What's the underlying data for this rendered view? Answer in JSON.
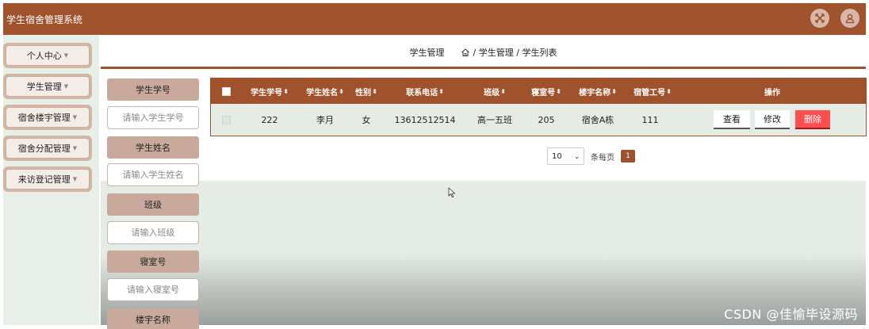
{
  "app": {
    "title": "学生宿舍管理系统"
  },
  "header_icons": [
    {
      "icon": "fullscreen-icon"
    },
    {
      "icon": "user-icon"
    }
  ],
  "sidebar": {
    "items": [
      {
        "label": "个人中心"
      },
      {
        "label": "学生管理"
      },
      {
        "label": "宿舍楼宇管理"
      },
      {
        "label": "宿舍分配管理"
      },
      {
        "label": "来访登记管理"
      }
    ]
  },
  "breadcrumb": {
    "section": "学生管理",
    "path": "/ 学生管理 / 学生列表",
    "home_icon": "home-icon"
  },
  "filters": [
    {
      "label": "学生学号",
      "placeholder": "请输入学生学号"
    },
    {
      "label": "学生姓名",
      "placeholder": "请输入学生姓名"
    },
    {
      "label": "班级",
      "placeholder": "请输入班级"
    },
    {
      "label": "寝室号",
      "placeholder": "请输入寝室号"
    },
    {
      "label": "楼宇名称",
      "placeholder": ""
    }
  ],
  "table": {
    "headers": {
      "student_id": "学生学号",
      "student_name": "学生姓名",
      "gender": "性别",
      "phone": "联系电话",
      "class": "班级",
      "room": "寝室号",
      "building": "楼宇名称",
      "manager_id": "宿管工号",
      "actions": "操作"
    },
    "rows": [
      {
        "student_id": "222",
        "student_name": "李月",
        "gender": "女",
        "phone": "13612512514",
        "class": "高一五班",
        "room": "205",
        "building": "宿舍A栋",
        "manager_id": "111",
        "view": "查看",
        "edit": "修改",
        "delete": "删除"
      }
    ]
  },
  "pagination": {
    "page_size": "10",
    "per_page_label": "条每页",
    "current_page": "1"
  },
  "watermark": "CSDN @佳愉毕设源码",
  "colors": {
    "primary": "#a0522d",
    "danger": "#ff4e4e",
    "row_bg": "#e4ece5"
  }
}
